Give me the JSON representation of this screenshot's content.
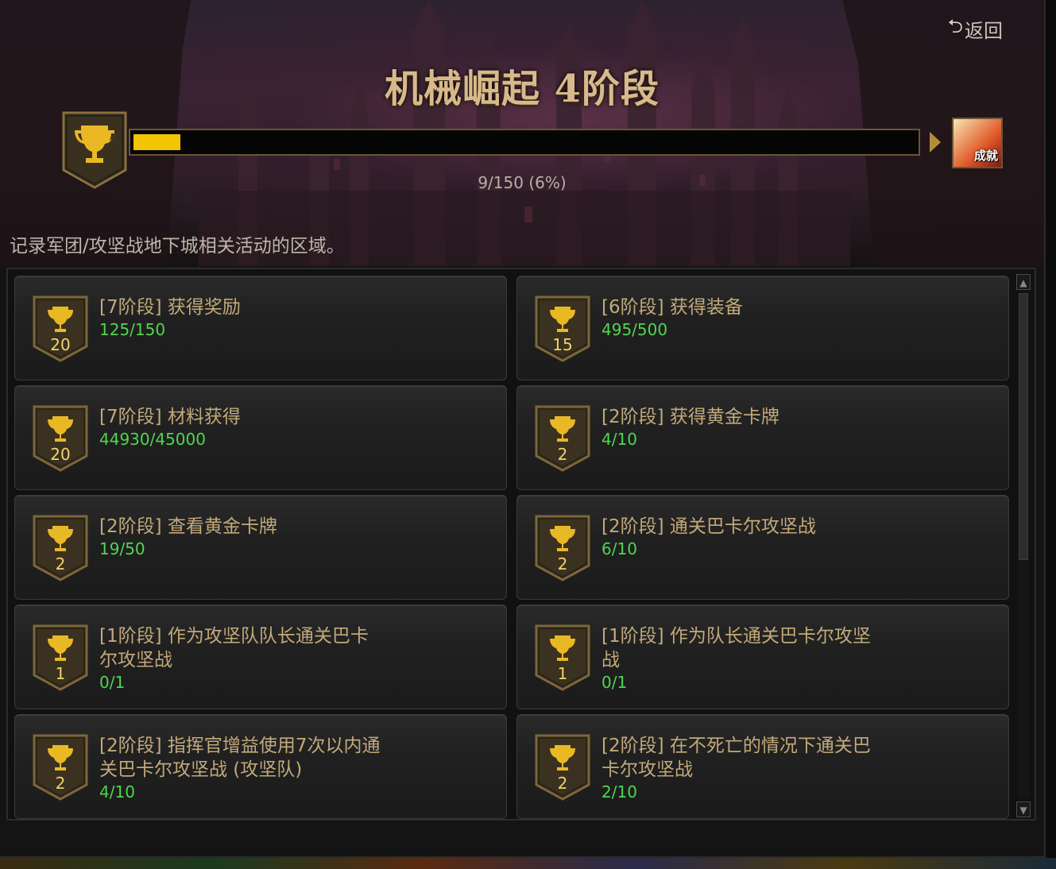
{
  "header": {
    "back_label": "返回",
    "back_icon": "return-arrow-icon",
    "title": "机械崛起 4阶段",
    "progress_text": "9/150 (6%)",
    "progress_value": 0.06,
    "achievement_icon_label": "成就",
    "description": "记录军团/攻坚战地下城相关活动的区域。"
  },
  "achievements": [
    {
      "badge": "20",
      "name": "[7阶段] 获得奖励",
      "count": "125/150"
    },
    {
      "badge": "15",
      "name": "[6阶段] 获得装备",
      "count": "495/500"
    },
    {
      "badge": "20",
      "name": "[7阶段] 材料获得",
      "count": "44930/45000"
    },
    {
      "badge": "2",
      "name": "[2阶段] 获得黄金卡牌",
      "count": "4/10"
    },
    {
      "badge": "2",
      "name": "[2阶段] 查看黄金卡牌",
      "count": "19/50"
    },
    {
      "badge": "2",
      "name": "[2阶段] 通关巴卡尔攻坚战",
      "count": "6/10"
    },
    {
      "badge": "1",
      "name": "[1阶段] 作为攻坚队队长通关巴卡尔攻坚战",
      "count": "0/1"
    },
    {
      "badge": "1",
      "name": "[1阶段] 作为队长通关巴卡尔攻坚战",
      "count": "0/1"
    },
    {
      "badge": "2",
      "name": "[2阶段] 指挥官增益使用7次以内通关巴卡尔攻坚战 (攻坚队)",
      "count": "4/10"
    },
    {
      "badge": "2",
      "name": "[2阶段] 在不死亡的情况下通关巴卡尔攻坚战",
      "count": "2/10"
    }
  ],
  "colors": {
    "progress_fill": "#f3c400",
    "count_green": "#4fd64f",
    "badge_gold": "#e9b825",
    "name_tan": "#c3a97a"
  }
}
